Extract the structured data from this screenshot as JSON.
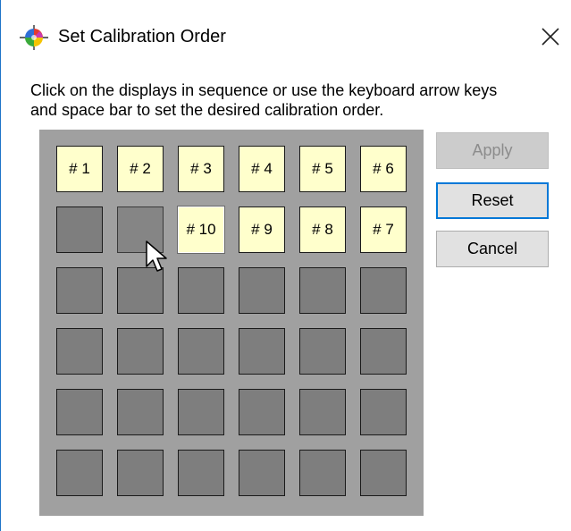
{
  "window": {
    "title": "Set Calibration Order",
    "icon": "calibration-color-wheel-icon"
  },
  "instructions": {
    "line1": "Click on the displays in sequence or use the keyboard arrow keys",
    "line2": "and space bar to set the desired calibration order."
  },
  "grid": {
    "rows": 6,
    "cols": 6,
    "cells": [
      [
        "# 1",
        "# 2",
        "# 3",
        "# 4",
        "# 5",
        "# 6"
      ],
      [
        "",
        "",
        "# 10",
        "# 9",
        "# 8",
        "# 7"
      ],
      [
        "",
        "",
        "",
        "",
        "",
        ""
      ],
      [
        "",
        "",
        "",
        "",
        "",
        ""
      ],
      [
        "",
        "",
        "",
        "",
        "",
        ""
      ],
      [
        "",
        "",
        "",
        "",
        "",
        ""
      ]
    ],
    "focused_cell": "r1c2",
    "hover_cell": "r1c1"
  },
  "buttons": {
    "apply": "Apply",
    "reset": "Reset",
    "cancel": "Cancel"
  },
  "colors": {
    "assigned_cell": "#ffffcc",
    "empty_cell": "#7e7e7e",
    "panel_bg": "#a0a0a0",
    "default_button_border": "#0078d7",
    "disabled_text": "#8c8c8c"
  }
}
